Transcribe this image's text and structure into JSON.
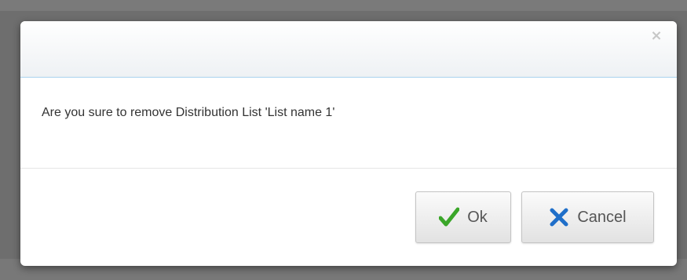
{
  "dialog": {
    "close_symbol": "×",
    "message": "Are you sure to remove Distribution List 'List name 1'",
    "buttons": {
      "ok_label": "Ok",
      "cancel_label": "Cancel"
    }
  },
  "icons": {
    "close": "close-icon",
    "ok": "checkmark-icon",
    "cancel": "x-mark-icon"
  },
  "colors": {
    "ok_icon": "#3aa629",
    "cancel_icon": "#1f6fc9",
    "header_border": "#a9d3ee"
  }
}
